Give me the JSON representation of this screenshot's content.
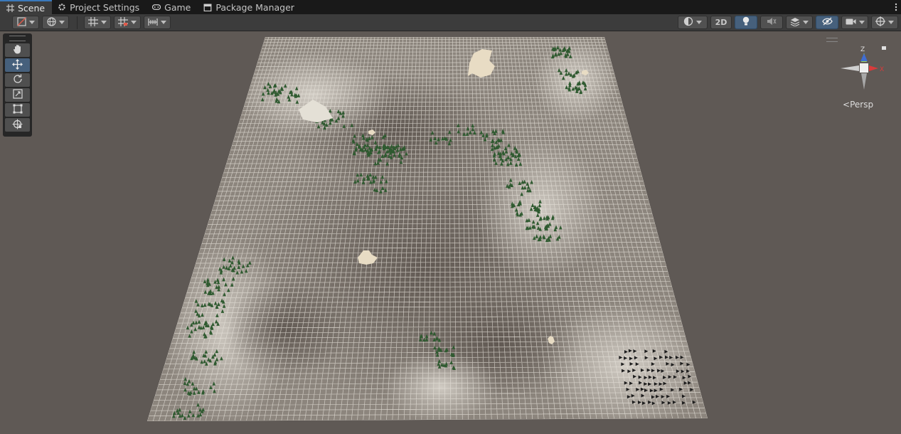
{
  "tabs": [
    {
      "label": "Scene",
      "icon": "grid-icon",
      "active": true
    },
    {
      "label": "Project Settings",
      "icon": "gear-icon",
      "active": false
    },
    {
      "label": "Game",
      "icon": "gamepad-icon",
      "active": false
    },
    {
      "label": "Package Manager",
      "icon": "package-icon",
      "active": false
    }
  ],
  "toolbar": {
    "left_buttons": [
      "draw-mode-icon",
      "global-icon",
      "grid-snap-icon",
      "increment-snap-icon",
      "ruler-icon"
    ],
    "two_d_label": "2D",
    "right_buttons": [
      "shading-mode-icon",
      "lighting-icon",
      "audio-icon",
      "effects-icon",
      "scene-visibility-icon",
      "camera-icon",
      "gizmos-icon"
    ]
  },
  "tools": [
    "hand-icon",
    "move-icon",
    "rotate-icon",
    "scale-icon",
    "rect-tool-icon",
    "transform-icon"
  ],
  "active_tool": "move-icon",
  "gizmo": {
    "x_label": "X",
    "z_label": "Z",
    "projection": "Persp"
  },
  "colors": {
    "accent": "#3a79bb",
    "gizmo_x": "#d83b3b",
    "gizmo_y": "#b6e36a",
    "gizmo_z": "#3b68d8",
    "ground": "#6f6760",
    "grid": "#e8e4dc",
    "trees": "#2f5a30"
  }
}
